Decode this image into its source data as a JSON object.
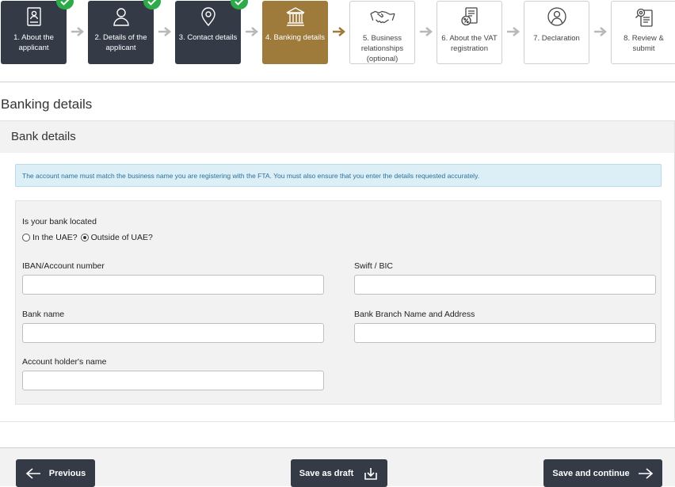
{
  "steps": [
    {
      "label": "1. About the applicant",
      "state": "done",
      "icon": "document-person-icon"
    },
    {
      "label": "2. Details of the applicant",
      "state": "done",
      "icon": "person-icon"
    },
    {
      "label": "3. Contact details",
      "state": "done",
      "icon": "location-pin-icon"
    },
    {
      "label": "4. Banking details",
      "state": "active",
      "icon": "bank-icon"
    },
    {
      "label": "5. Business relationships (optional)",
      "state": "todo",
      "icon": "handshake-icon"
    },
    {
      "label": "6. About the VAT registration",
      "state": "todo",
      "icon": "vat-document-icon"
    },
    {
      "label": "7. Declaration",
      "state": "todo",
      "icon": "declaration-person-icon"
    },
    {
      "label": "8. Review & submit",
      "state": "todo",
      "icon": "review-document-icon"
    }
  ],
  "page_title": "Banking details",
  "panel_title": "Bank details",
  "notice": "The account name must match the business name you are registering with the FTA. You must also ensure that you enter the details requested accurately.",
  "form": {
    "question": "Is your bank located",
    "options": [
      {
        "label": "In the UAE?",
        "selected": false
      },
      {
        "label": "Outside of UAE?",
        "selected": true
      }
    ],
    "fields": {
      "iban_label": "IBAN/Account number",
      "iban_value": "",
      "swift_label": "Swift / BIC",
      "swift_value": "",
      "bank_name_label": "Bank name",
      "bank_name_value": "",
      "branch_label": "Bank Branch Name and Address",
      "branch_value": "",
      "holder_label": "Account holder's name",
      "holder_value": ""
    }
  },
  "footer": {
    "previous_label": "Previous",
    "draft_label": "Save as draft",
    "continue_label": "Save and continue"
  },
  "colors": {
    "done": "#343a46",
    "active": "#9e7a3b",
    "check": "#2eaa4a",
    "notice_bg": "#dceef6",
    "notice_text": "#2a7299"
  }
}
